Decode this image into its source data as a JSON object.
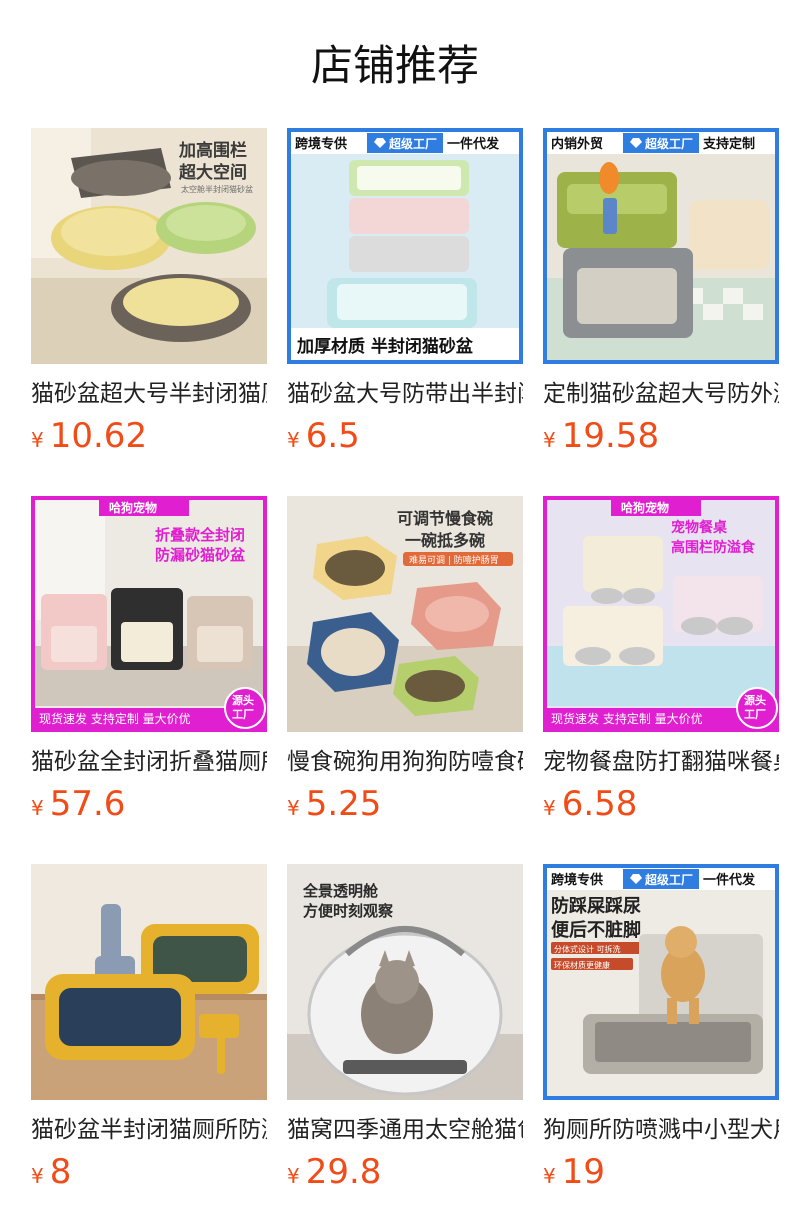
{
  "page": {
    "title": "店铺推荐",
    "currency": "¥"
  },
  "products": [
    {
      "name": "猫砂盆超大号半封闭猫厕所",
      "price": "10.62",
      "image_text": [
        "加高围栏",
        "超大空间",
        "太空舱半封闭猫砂盆"
      ]
    },
    {
      "name": "猫砂盆大号防带出半封闭",
      "price": "6.5",
      "image_text": [
        "跨境专供",
        "超级工厂",
        "一件代发",
        "加厚材质 半封闭猫砂盆"
      ]
    },
    {
      "name": "定制猫砂盆超大号防外溅",
      "price": "19.58",
      "image_text": [
        "内销外贸",
        "超级工厂",
        "支持定制"
      ]
    },
    {
      "name": "猫砂盆全封闭折叠猫厕所",
      "price": "57.6",
      "image_text": [
        "哈狗宠物",
        "折叠款全封闭",
        "防漏砂猫砂盆",
        "现货速发 支持定制 量大价优",
        "源头",
        "工厂"
      ]
    },
    {
      "name": "慢食碗狗用狗狗防噎食碗",
      "price": "5.25",
      "image_text": [
        "可调节慢食碗",
        "一碗抵多碗",
        "难易可调 | 防噎护肠胃"
      ]
    },
    {
      "name": "宠物餐盘防打翻猫咪餐桌",
      "price": "6.58",
      "image_text": [
        "哈狗宠物",
        "宠物餐桌",
        "高围栏防溢食",
        "现货速发 支持定制 量大价优",
        "源头",
        "工厂"
      ]
    },
    {
      "name": "猫砂盆半封闭猫厕所防溅",
      "price": "8",
      "image_text": []
    },
    {
      "name": "猫窝四季通用太空舱猫包",
      "price": "29.8",
      "image_text": [
        "全景透明舱",
        "方便时刻观察"
      ]
    },
    {
      "name": "狗厕所防喷溅中小型犬用",
      "price": "19",
      "image_text": [
        "跨境专供",
        "超级工厂",
        "一件代发",
        "防踩屎踩尿",
        "便后不脏脚",
        "分体式设计 可拆洗",
        "环保材质更健康"
      ]
    }
  ],
  "colors": {
    "price": "#f04c18",
    "title": "#111111",
    "name": "#222222",
    "banner_blue": "#2f7de1",
    "banner_magenta": "#e020d0"
  },
  "icons": {
    "diamond": "diamond-icon"
  }
}
